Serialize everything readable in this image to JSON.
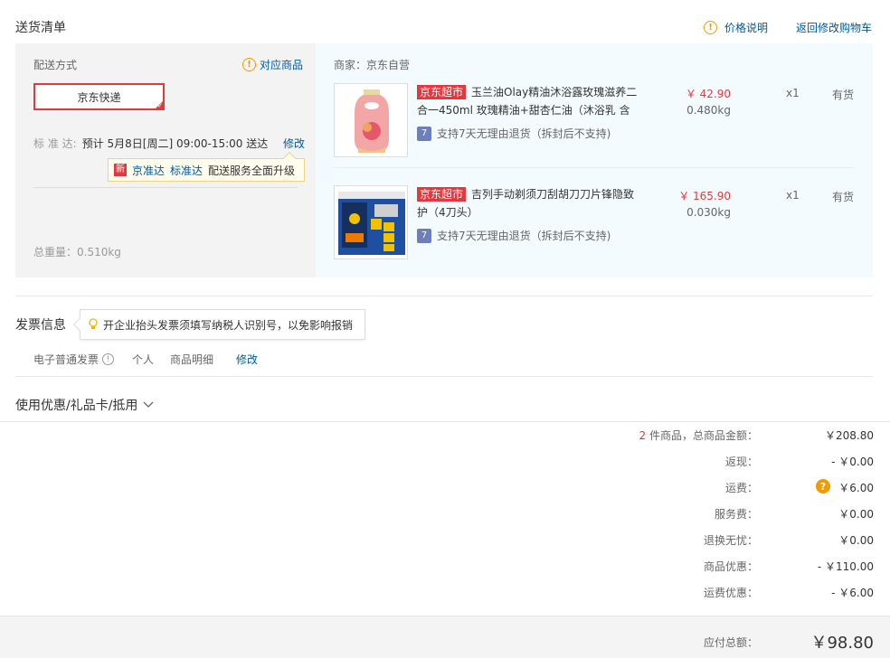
{
  "header": {
    "title": "送货清单",
    "price_note": "价格说明",
    "back_to_cart": "返回修改购物车"
  },
  "delivery": {
    "method_label": "配送方式",
    "matched_products": "对应商品",
    "selected_method": "京东快递",
    "standard_label": "标 准 达:",
    "standard_time": "预计 5月8日[周二] 09:00-15:00 送达",
    "modify": "修改",
    "tip": {
      "badge": "新",
      "link1": "京准达",
      "link2": "标准达",
      "text": "配送服务全面升级"
    },
    "total_weight": "总重量：0.510kg"
  },
  "seller": {
    "label": "商家：京东自营"
  },
  "products": [
    {
      "tag": "京东超市",
      "name": "玉兰油Olay精油沐浴露玫瑰滋养二合一450ml 玫瑰精油+甜杏仁油（沐浴乳 含",
      "price": "￥ 42.90",
      "weight": "0.480kg",
      "qty": "x1",
      "stock": "有货",
      "service": "支持7天无理由退货（拆封后不支持)"
    },
    {
      "tag": "京东超市",
      "name": "吉列手动剃须刀刮胡刀刀片锋隐致护（4刀头）",
      "price": "￥ 165.90",
      "weight": "0.030kg",
      "qty": "x1",
      "stock": "有货",
      "service": "支持7天无理由退货（拆封后不支持)"
    }
  ],
  "invoice": {
    "title": "发票信息",
    "tip": "开企业抬头发票须填写纳税人识别号，以免影响报销",
    "type": "电子普通发票",
    "recipient": "个人",
    "content": "商品明细",
    "modify": "修改"
  },
  "coupons": {
    "label": "使用优惠/礼品卡/抵用"
  },
  "summary": {
    "count": "2",
    "count_suffix": " 件商品，总商品金额：",
    "subtotal": "￥208.80",
    "rebate_label": "返现：",
    "rebate": "- ￥0.00",
    "freight_label": "运费：",
    "freight": "￥6.00",
    "service_label": "服务费：",
    "service": "￥0.00",
    "exchange_label": "退换无忧：",
    "exchange": "￥0.00",
    "discount_label": "商品优惠：",
    "discount": "- ￥110.00",
    "freight_discount_label": "运费优惠：",
    "freight_discount": "- ￥6.00",
    "total_label": "应付总额：",
    "total": "￥98.80"
  }
}
